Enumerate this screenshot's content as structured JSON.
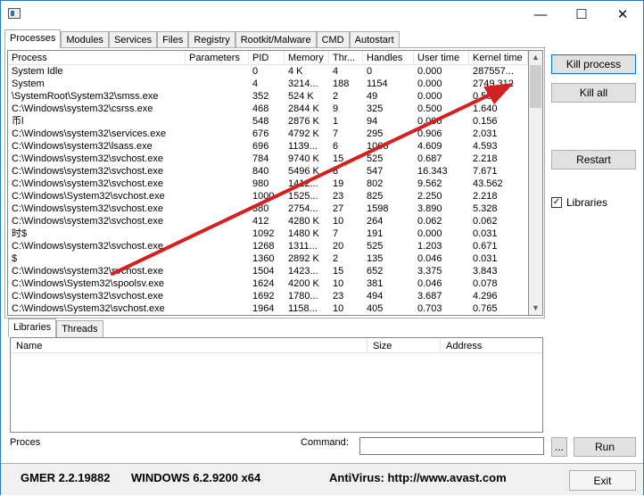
{
  "window": {
    "controls": [
      "minimize",
      "maximize",
      "close"
    ]
  },
  "tabs": [
    "Processes",
    "Modules",
    "Services",
    "Files",
    "Registry",
    "Rootkit/Malware",
    "CMD",
    "Autostart"
  ],
  "columns": [
    "Process",
    "Parameters",
    "PID",
    "Memory",
    "Thr...",
    "Handles",
    "User time",
    "Kernel time"
  ],
  "rows": [
    [
      "System Idle",
      "",
      "0",
      "4 K",
      "4",
      "0",
      "0.000",
      "287557..."
    ],
    [
      "System",
      "",
      "4",
      "3214...",
      "188",
      "1154",
      "0.000",
      "2749.312"
    ],
    [
      "\\SystemRoot\\System32\\smss.exe",
      "",
      "352",
      "524 K",
      "2",
      "49",
      "0.000",
      "0.593"
    ],
    [
      "C:\\Windows\\system32\\csrss.exe",
      "",
      "468",
      "2844 K",
      "9",
      "325",
      "0.500",
      "1.640"
    ],
    [
      "币l",
      "",
      "548",
      "2876 K",
      "1",
      "94",
      "0.000",
      "0.156"
    ],
    [
      "C:\\Windows\\system32\\services.exe",
      "",
      "676",
      "4792 K",
      "7",
      "295",
      "0.906",
      "2.031"
    ],
    [
      "C:\\Windows\\system32\\lsass.exe",
      "",
      "696",
      "1139...",
      "6",
      "1066",
      "4.609",
      "4.593"
    ],
    [
      "C:\\Windows\\system32\\svchost.exe",
      "",
      "784",
      "9740 K",
      "15",
      "525",
      "0.687",
      "2.218"
    ],
    [
      "C:\\Windows\\system32\\svchost.exe",
      "",
      "840",
      "5496 K",
      "8",
      "547",
      "16.343",
      "7.671"
    ],
    [
      "C:\\Windows\\system32\\svchost.exe",
      "",
      "980",
      "1412...",
      "19",
      "802",
      "9.562",
      "43.562"
    ],
    [
      "C:\\Windows\\System32\\svchost.exe",
      "",
      "1000",
      "1525...",
      "23",
      "825",
      "2.250",
      "2.218"
    ],
    [
      "C:\\Windows\\system32\\svchost.exe",
      "",
      "380",
      "2754...",
      "27",
      "1598",
      "3.890",
      "5.328"
    ],
    [
      "C:\\Windows\\system32\\svchost.exe",
      "",
      "412",
      "4280 K",
      "10",
      "264",
      "0.062",
      "0.062"
    ],
    [
      "时$",
      "",
      "1092",
      "1480 K",
      "7",
      "191",
      "0.000",
      "0.031"
    ],
    [
      "C:\\Windows\\system32\\svchost.exe",
      "",
      "1268",
      "1311...",
      "20",
      "525",
      "1.203",
      "0.671"
    ],
    [
      " $",
      "",
      "1360",
      "2892 K",
      "2",
      "135",
      "0.046",
      "0.031"
    ],
    [
      "C:\\Windows\\system32\\svchost.exe",
      "",
      "1504",
      "1423...",
      "15",
      "652",
      "3.375",
      "3.843"
    ],
    [
      "C:\\Windows\\System32\\spoolsv.exe",
      "",
      "1624",
      "4200 K",
      "10",
      "381",
      "0.046",
      "0.078"
    ],
    [
      "C:\\Windows\\system32\\svchost.exe",
      "",
      "1692",
      "1780...",
      "23",
      "494",
      "3.687",
      "4.296"
    ],
    [
      "C:\\Windows\\System32\\svchost.exe",
      "",
      "1964",
      "1158...",
      "10",
      "405",
      "0.703",
      "0.765"
    ]
  ],
  "side": {
    "kill_process": "Kill process",
    "kill_all": "Kill all",
    "restart": "Restart",
    "libraries": "Libraries",
    "libraries_checked": true
  },
  "subtabs": [
    "Libraries",
    "Threads"
  ],
  "lib_columns": [
    "Name",
    "Size",
    "Address"
  ],
  "bottom": {
    "proces_label": "Proces",
    "command_label": "Command:",
    "command_value": "",
    "browse": "...",
    "run": "Run"
  },
  "status": {
    "version": "GMER 2.2.19882",
    "os": "WINDOWS 6.2.9200  x64",
    "antivirus": "AntiVirus: http://www.avast.com",
    "exit": "Exit"
  },
  "colors": {
    "annotation_arrow": "#d42020",
    "accent": "#0078d7"
  }
}
